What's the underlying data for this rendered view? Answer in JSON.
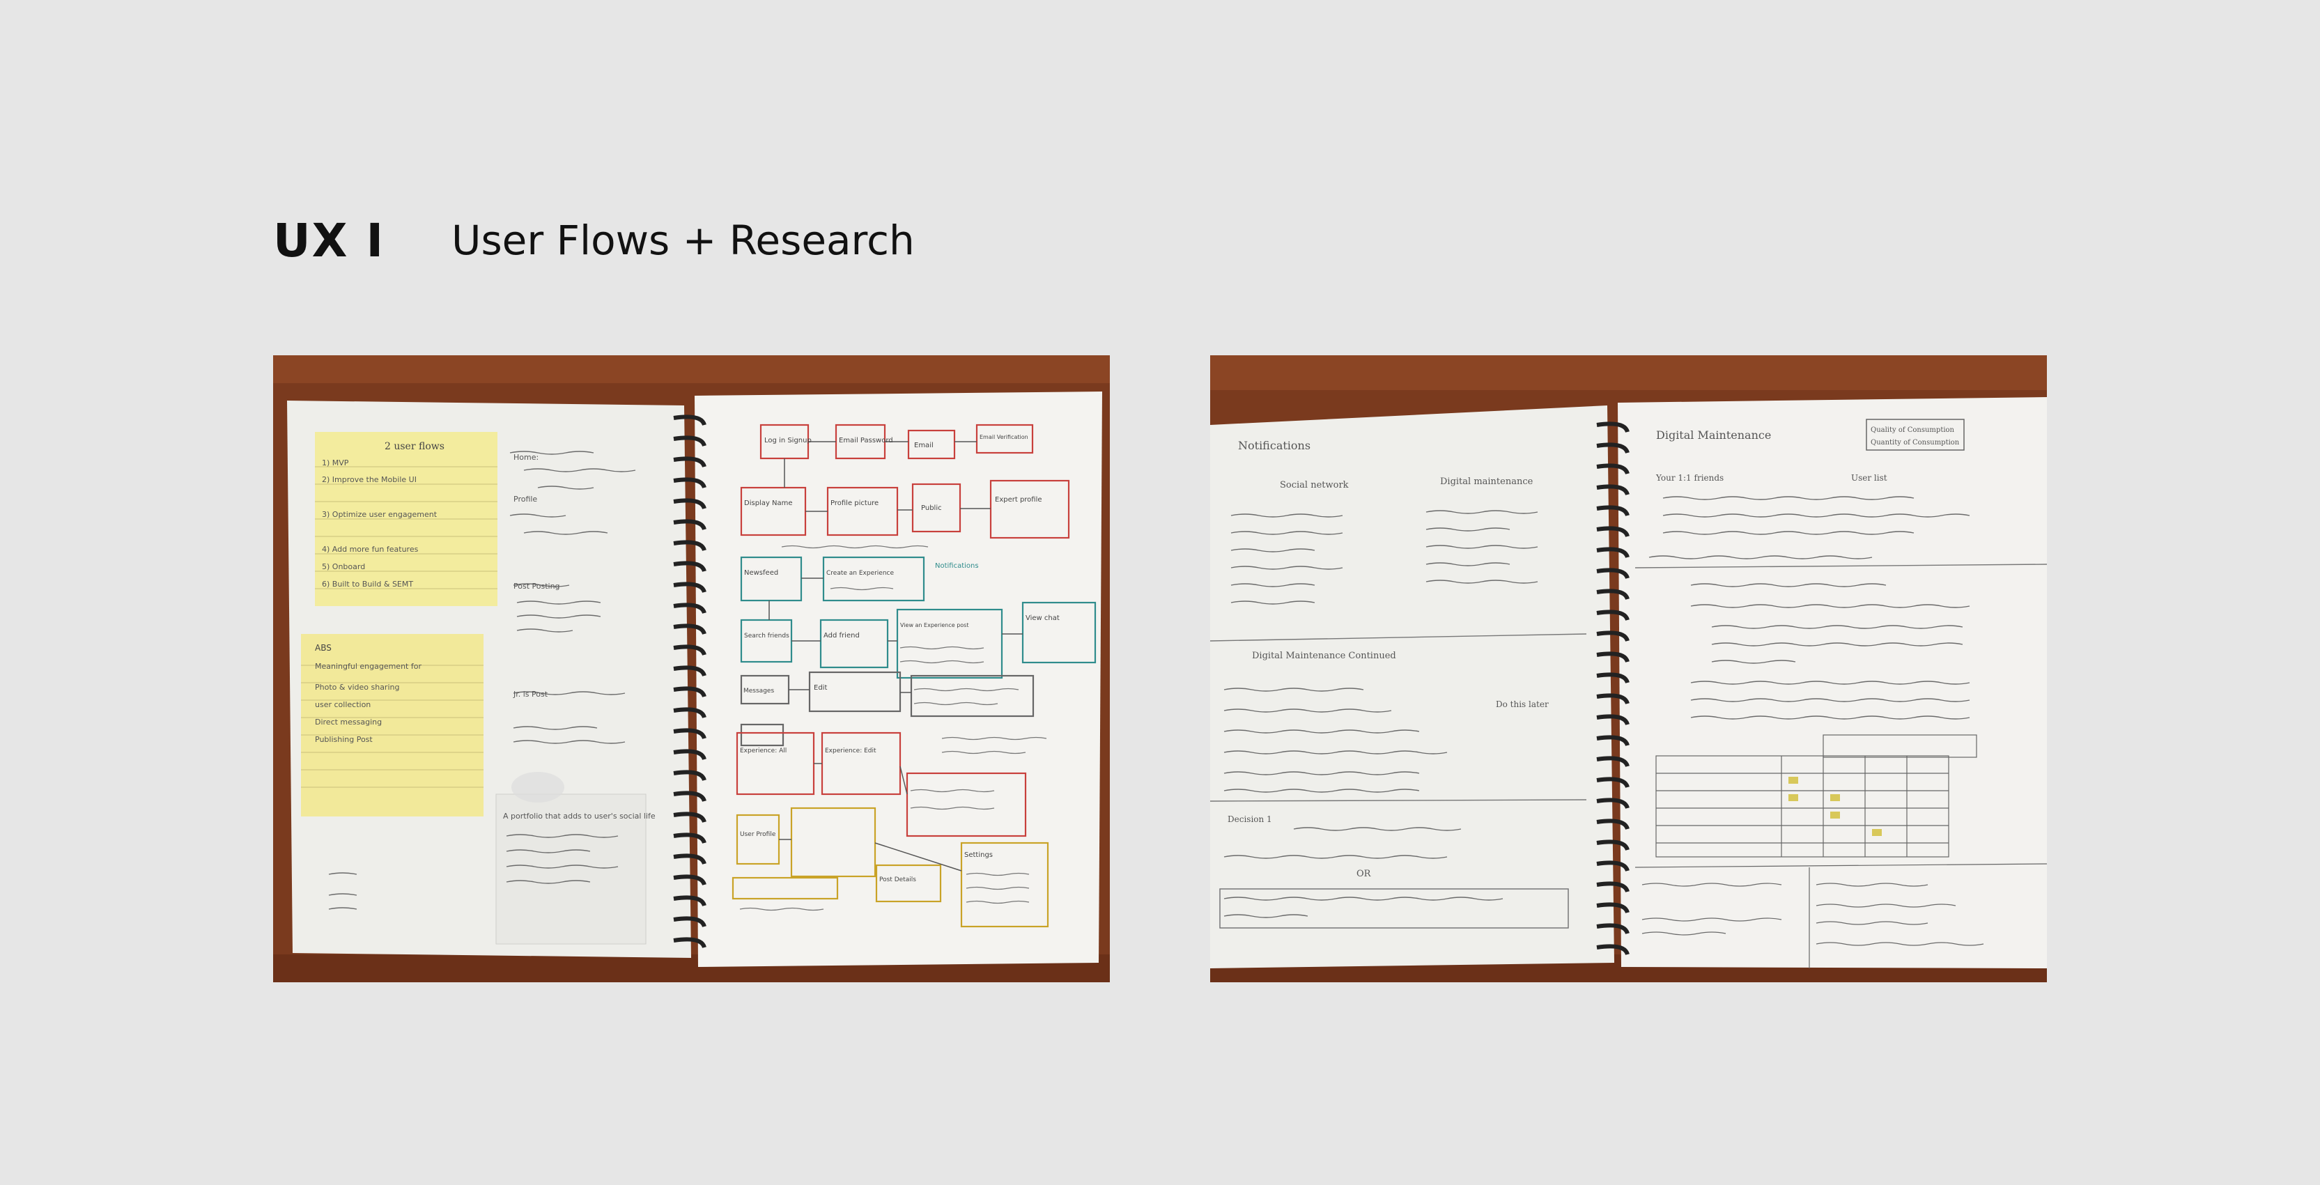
{
  "header": {
    "title": "UX I",
    "subtitle": "User Flows + Research"
  },
  "photos": [
    {
      "name": "left-notebook-photo",
      "left_page": {
        "sticky_top": [
          "2 user flows",
          "1) MVP",
          "2) Improve the Mobile UI",
          "3) Optimize user engagement",
          "4) Add more  fun features",
          "5) Onboard",
          "6) Built to Build & SEMT"
        ],
        "sticky_bottom": [
          "ABS",
          "Meaningful engagement for",
          "Photo & video sharing",
          "user collection",
          "Direct messaging",
          "Publishing Post"
        ],
        "notes": [
          "Home:",
          "Profile",
          "Post Posting",
          "Jr. is Post",
          "A portfolio that adds to user's social life"
        ]
      },
      "right_page": {
        "boxes": [
          "Log in Signup",
          "Email Password",
          "Email",
          "Email Verification",
          "Display Name",
          "Profile picture",
          "Public",
          "Expert profile",
          "Newsfeed",
          "Create an Experience",
          "Notifications",
          "Search friends",
          "Add friend",
          "View an Experience post",
          "View chat",
          "Messages",
          "Edit",
          "Experience: All",
          "Experience: Edit",
          "User Profile",
          "Settings",
          "Post Details"
        ]
      }
    },
    {
      "name": "right-notebook-photo",
      "left_page": {
        "notes": [
          "Notifications",
          "Social network",
          "Digital maintenance",
          "Digital Maintenance Continued",
          "Do this later",
          "Decision 1",
          "OR"
        ]
      },
      "right_page": {
        "notes": [
          "Digital Maintenance",
          "Quality of Consumption",
          "Quantity of Consumption",
          "Your 1:1 friends",
          "User list"
        ]
      }
    }
  ],
  "colors": {
    "background": "#e6e6e6",
    "table": "#7a3a1e",
    "paper": "#f2f1ee",
    "sticky": "#f2ea9a",
    "ink": "#555555",
    "red_ink": "#c8403c",
    "teal_ink": "#2f8c8c",
    "gold_ink": "#c9a327"
  }
}
